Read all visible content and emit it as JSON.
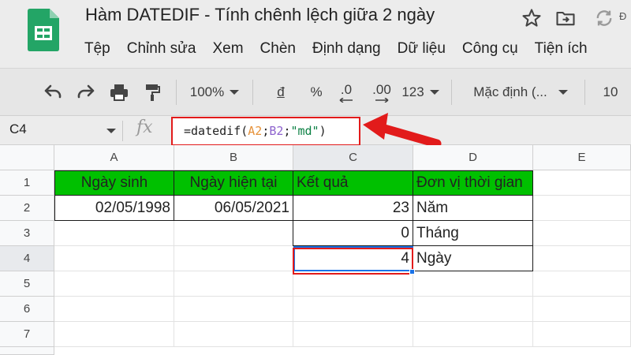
{
  "title_bar": {
    "doc_title": "Hàm DATEDIF - Tính chênh lệch giữa 2 ngày",
    "saved_text": "Đ"
  },
  "menu": {
    "items": [
      "Tệp",
      "Chỉnh sửa",
      "Xem",
      "Chèn",
      "Định dạng",
      "Dữ liệu",
      "Công cụ",
      "Tiện ích"
    ]
  },
  "toolbar": {
    "zoom": "100%",
    "currency": "đ",
    "percent": "%",
    "dec_decrease": ".0",
    "dec_increase": ".00",
    "more_formats": "123",
    "font": "Mặc định (...",
    "font_size": "10"
  },
  "formula_bar": {
    "name_box": "C4",
    "fx": "fx",
    "formula_prefix": "=datedif(",
    "ref1": "A2",
    "sep1": ";",
    "ref2": "B2",
    "sep2": ";",
    "arg3": "\"md\"",
    "formula_suffix": ")"
  },
  "grid": {
    "columns": [
      "A",
      "B",
      "C",
      "D",
      "E"
    ],
    "rows": [
      "1",
      "2",
      "3",
      "4",
      "5",
      "6",
      "7"
    ],
    "cells": {
      "A1": "Ngày sinh",
      "B1": "Ngày hiện tại",
      "C1": "Kết quả",
      "D1": "Đơn vị thời gian",
      "A2": "02/05/1998",
      "B2": "06/05/2021",
      "C2": "23",
      "D2": "Năm",
      "C3": "0",
      "D3": "Tháng",
      "C4": "4",
      "D4": "Ngày"
    }
  },
  "colors": {
    "header_fill": "#00c000",
    "highlight_red": "#e21b1b",
    "selection_blue": "#1a73e8"
  }
}
